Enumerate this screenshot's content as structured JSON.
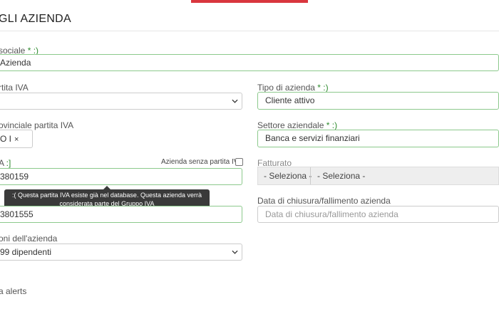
{
  "header": {
    "title": "GLI AZIENDA"
  },
  "form": {
    "ragione_sociale": {
      "label": "sociale",
      "required": " * :)",
      "value": "Azienda"
    },
    "partita_iva_select": {
      "label": "rtita IVA",
      "value": ""
    },
    "tipo_azienda": {
      "label": "Tipo di azienda",
      "required": " * :)",
      "value": "Cliente attivo"
    },
    "provinciale_iva": {
      "label": "ovinciale partita IVA",
      "tag": "O I",
      "remove": "×"
    },
    "settore": {
      "label": "Settore aziendale",
      "required": " * :)",
      "value": "Banca e servizi finanziari"
    },
    "iva": {
      "label": "A",
      "required": " :]",
      "value": "380159"
    },
    "senza_iva": {
      "label": "Azienda senza partita IVA"
    },
    "fatturato": {
      "label": "Fatturato",
      "option1": "- Seleziona -",
      "option2": "- Seleziona -"
    },
    "codice": {
      "value": "3801555"
    },
    "data_chiusura": {
      "label": "Data di chiusura/fallimento azienda",
      "placeholder": "Data di chiusura/fallimento azienda"
    },
    "dimensioni": {
      "label": "oni dell'azienda",
      "value": "99 dipendenti"
    },
    "alerts": {
      "label": "a alerts"
    }
  },
  "tooltip": {
    "line1": ":( Questa partita IVA esiste già nel database. Questa azienda verrà",
    "line2": "considerata parte del Gruppo IVA"
  },
  "colors": {
    "accent": "#d9363e",
    "valid_border": "#8cc98c",
    "required_mark": "#2e8b2e"
  }
}
